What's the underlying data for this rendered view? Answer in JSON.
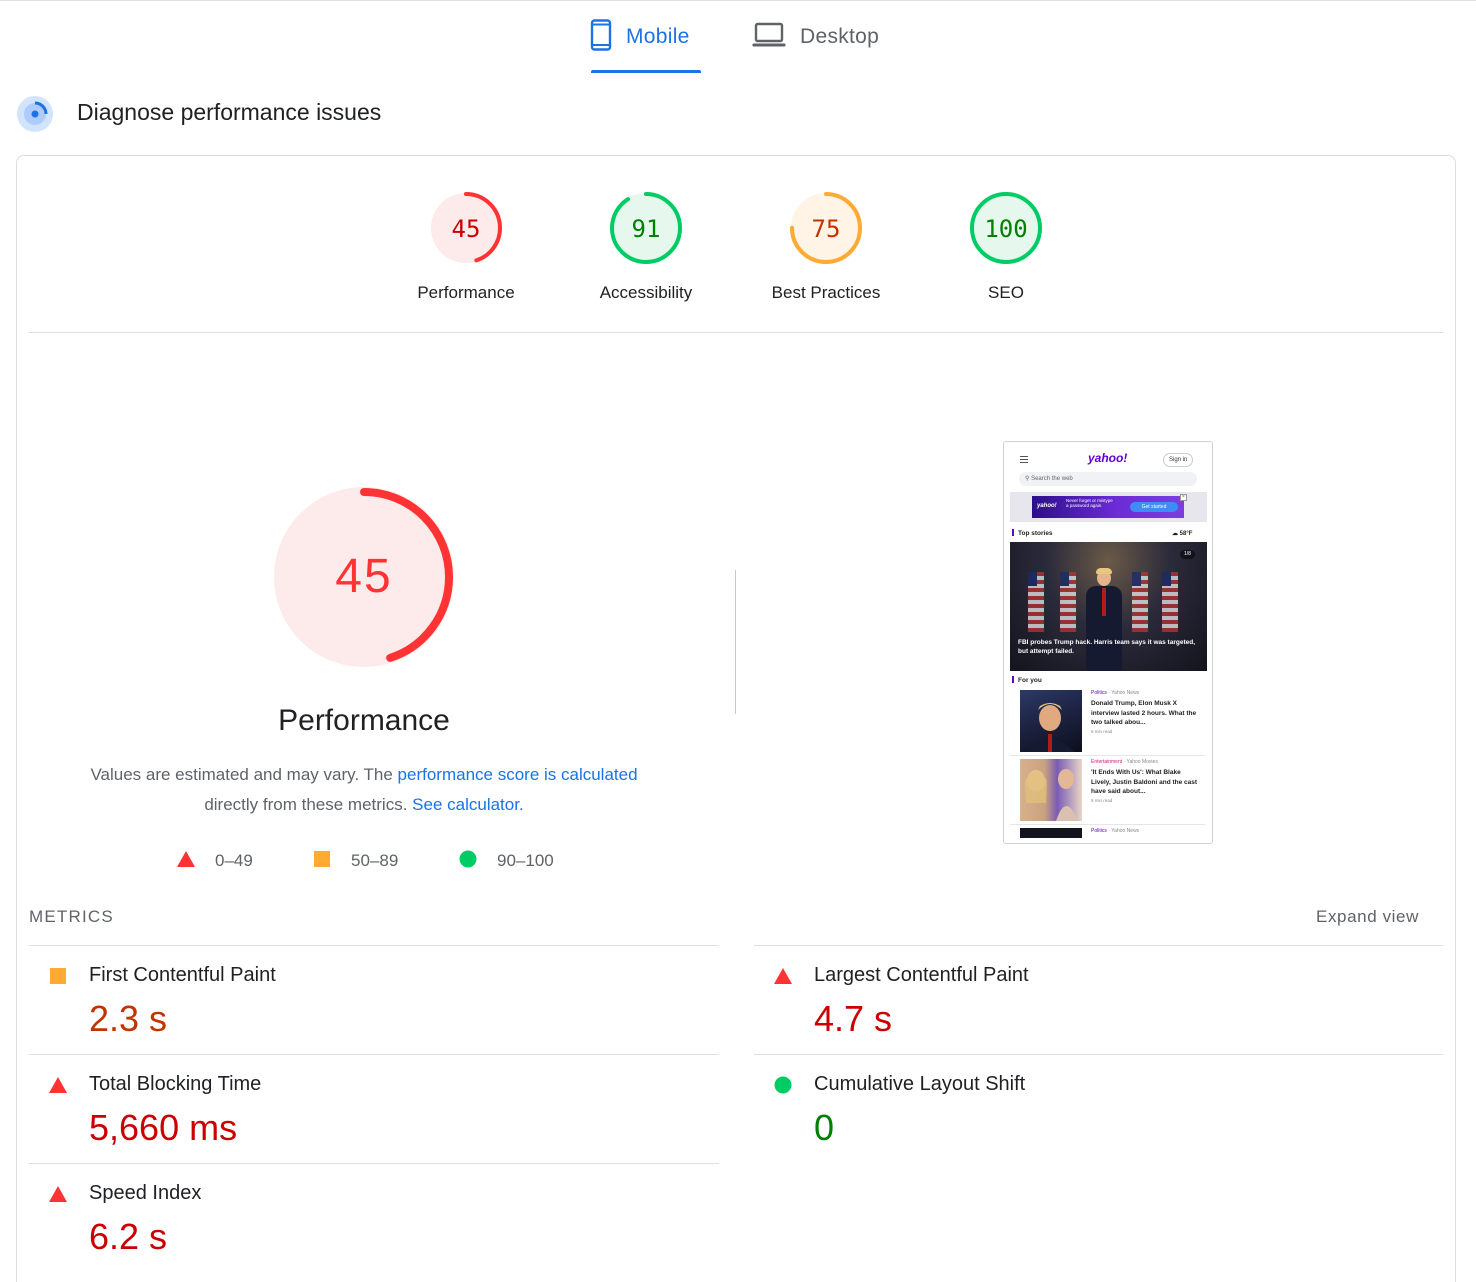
{
  "tabs": [
    {
      "label": "Mobile",
      "icon": "mobile-phone-icon",
      "active": true
    },
    {
      "label": "Desktop",
      "icon": "laptop-icon",
      "active": false
    }
  ],
  "section": {
    "title": "Diagnose performance issues"
  },
  "categories": [
    {
      "score": 45,
      "label": "Performance",
      "rating": "fail"
    },
    {
      "score": 91,
      "label": "Accessibility",
      "rating": "pass"
    },
    {
      "score": 75,
      "label": "Best Practices",
      "rating": "average"
    },
    {
      "score": 100,
      "label": "SEO",
      "rating": "pass"
    }
  ],
  "main_gauge": {
    "score": 45,
    "title": "Performance",
    "desc_prefix": "Values are estimated and may vary. The ",
    "desc_link": "performance score is calculated",
    "desc_middle": " directly from these metrics. ",
    "desc_link2": "See calculator."
  },
  "legend": [
    {
      "range": "0–49",
      "shape": "triangle",
      "color": "#ff3333"
    },
    {
      "range": "50–89",
      "shape": "square",
      "color": "#ffaa33"
    },
    {
      "range": "90–100",
      "shape": "circle",
      "color": "#00cc66"
    }
  ],
  "colors": {
    "fail": "#ff3333",
    "fail_bg": "#fdeaea",
    "fail_text": "#c00",
    "average": "#ffaa33",
    "average_bg": "#fff4e5",
    "average_text": "#c33300",
    "pass": "#00cc66",
    "pass_bg": "#e6f7ee",
    "pass_text": "#008000",
    "accent": "#1a73e8"
  },
  "screenshot": {
    "logo": "yahoo!",
    "signin": "Sign in",
    "search_placeholder": "Search the web",
    "ad_logo": "yahoo!",
    "ad_text": "Never forget or mistype a password again.",
    "ad_button": "Get started",
    "top_stories": "Top stories",
    "weather": "58°F",
    "hero_counter": "1/8",
    "hero_caption": "FBI probes Trump hack. Harris team says it was targeted, but attempt failed.",
    "for_you": "For you",
    "stories": [
      {
        "category": "Politics",
        "source": "Yahoo News",
        "title": "Donald Trump, Elon Musk X interview lasted 2 hours. What the two talked abou...",
        "read": "6 min read"
      },
      {
        "category": "Entertainment",
        "source": "Yahoo Movies",
        "title": "'It Ends With Us': What Blake Lively, Justin Baldoni and the cast have said about...",
        "read": "9 min read"
      },
      {
        "category": "Politics",
        "source": "Yahoo News"
      }
    ]
  },
  "metrics": {
    "label": "METRICS",
    "expand": "Expand view",
    "items": [
      {
        "name": "First Contentful Paint",
        "value": "2.3 s",
        "rating": "average"
      },
      {
        "name": "Largest Contentful Paint",
        "value": "4.7 s",
        "rating": "fail"
      },
      {
        "name": "Total Blocking Time",
        "value": "5,660 ms",
        "rating": "fail"
      },
      {
        "name": "Cumulative Layout Shift",
        "value": "0",
        "rating": "pass"
      },
      {
        "name": "Speed Index",
        "value": "6.2 s",
        "rating": "fail"
      }
    ]
  }
}
